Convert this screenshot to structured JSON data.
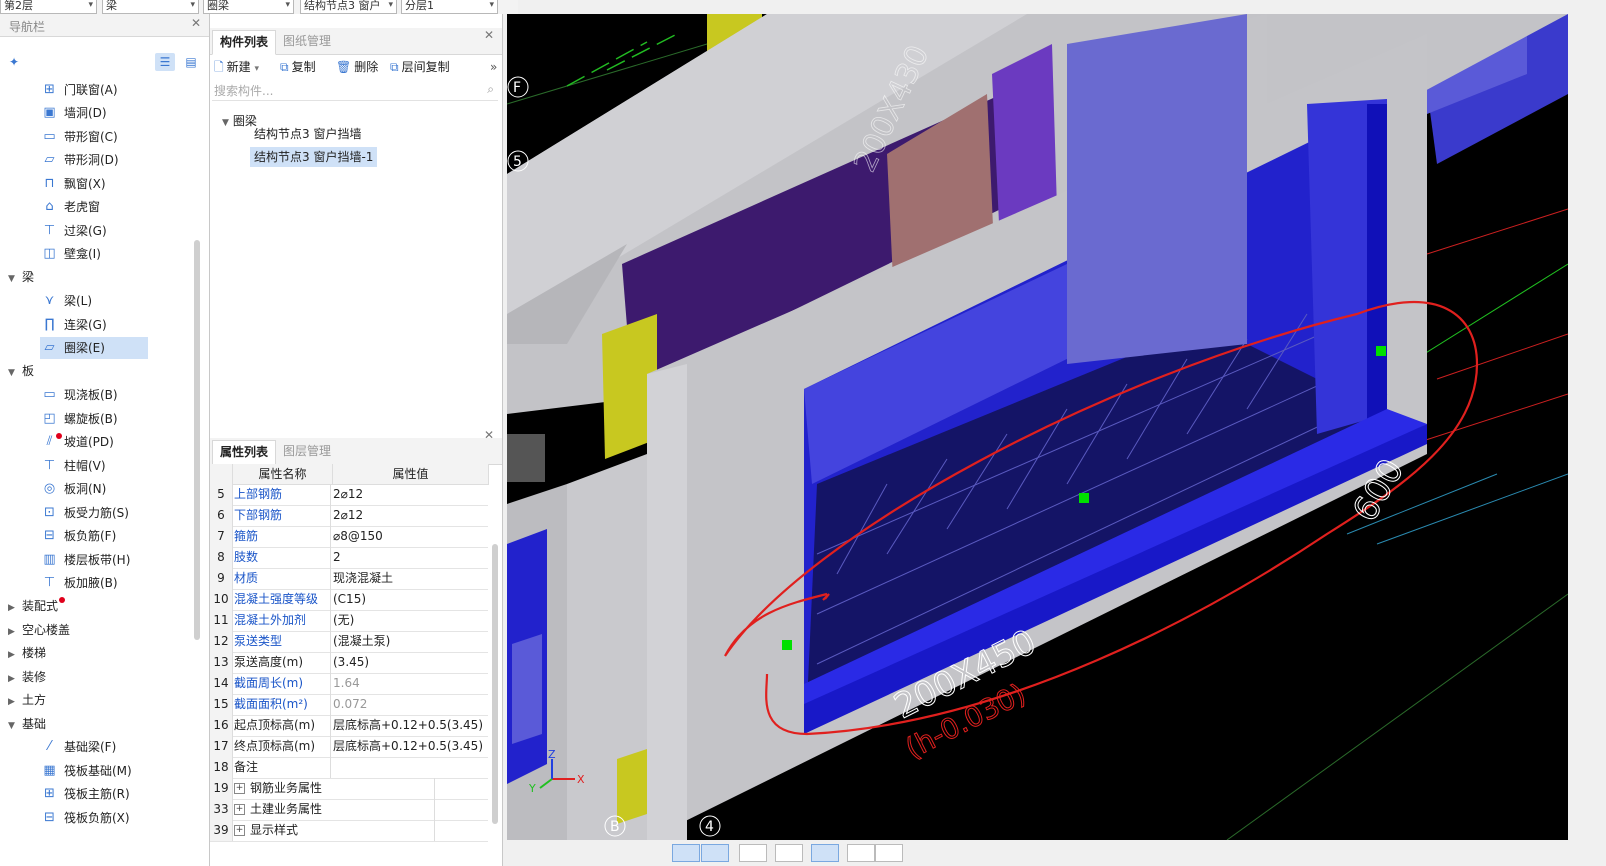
{
  "top_selectors": [
    "第2层",
    "梁",
    "圈梁",
    "结构节点3 窗户",
    "分层1"
  ],
  "nav": {
    "title": "导航栏",
    "items_opening": [
      {
        "label": "门联窗(A)",
        "icon": "door-window-icon"
      },
      {
        "label": "墙洞(D)",
        "icon": "wall-hole-icon"
      },
      {
        "label": "带形窗(C)",
        "icon": "strip-window-icon"
      },
      {
        "label": "带形洞(D)",
        "icon": "strip-hole-icon"
      },
      {
        "label": "飘窗(X)",
        "icon": "bay-window-icon"
      },
      {
        "label": "老虎窗",
        "icon": "dormer-icon"
      },
      {
        "label": "过梁(G)",
        "icon": "lintel-icon"
      },
      {
        "label": "壁龛(I)",
        "icon": "niche-icon"
      }
    ],
    "group_beam": "梁",
    "items_beam": [
      {
        "label": "梁(L)",
        "icon": "beam-icon"
      },
      {
        "label": "连梁(G)",
        "icon": "coupling-beam-icon"
      },
      {
        "label": "圈梁(E)",
        "icon": "ring-beam-icon"
      }
    ],
    "group_slab": "板",
    "items_slab": [
      {
        "label": "现浇板(B)",
        "icon": "cast-slab-icon"
      },
      {
        "label": "螺旋板(B)",
        "icon": "spiral-slab-icon"
      },
      {
        "label": "坡道(PD)",
        "icon": "ramp-icon"
      },
      {
        "label": "柱帽(V)",
        "icon": "column-cap-icon"
      },
      {
        "label": "板洞(N)",
        "icon": "slab-hole-icon"
      },
      {
        "label": "板受力筋(S)",
        "icon": "slab-rebar-icon"
      },
      {
        "label": "板负筋(F)",
        "icon": "slab-neg-rebar-icon"
      },
      {
        "label": "楼层板带(H)",
        "icon": "slab-strip-icon"
      },
      {
        "label": "板加腋(B)",
        "icon": "slab-haunch-icon"
      }
    ],
    "collapsed_groups": [
      "装配式",
      "空心楼盖",
      "楼梯",
      "装修",
      "土方"
    ],
    "group_foundation": "基础",
    "items_foundation": [
      {
        "label": "基础梁(F)",
        "icon": "foundation-beam-icon"
      },
      {
        "label": "筏板基础(M)",
        "icon": "raft-foundation-icon"
      },
      {
        "label": "筏板主筋(R)",
        "icon": "raft-main-rebar-icon"
      },
      {
        "label": "筏板负筋(X)",
        "icon": "raft-neg-rebar-icon"
      }
    ]
  },
  "component": {
    "tabs": [
      "构件列表",
      "图纸管理"
    ],
    "toolbar": {
      "new": "新建",
      "copy": "复制",
      "delete": "删除",
      "floor_copy": "层间复制"
    },
    "search_placeholder": "搜索构件...",
    "tree_root": "圈梁",
    "tree_items": [
      "结构节点3 窗户挡墙",
      "结构节点3 窗户挡墙-1"
    ]
  },
  "properties": {
    "tabs": [
      "属性列表",
      "图层管理"
    ],
    "headers": [
      "属性名称",
      "属性值"
    ],
    "rows": [
      {
        "no": "5",
        "name": "上部钢筋",
        "value": "2⌀12",
        "blue": true
      },
      {
        "no": "6",
        "name": "下部钢筋",
        "value": "2⌀12",
        "blue": true
      },
      {
        "no": "7",
        "name": "箍筋",
        "value": "⌀8@150",
        "blue": true
      },
      {
        "no": "8",
        "name": "肢数",
        "value": "2",
        "blue": true
      },
      {
        "no": "9",
        "name": "材质",
        "value": "现浇混凝土",
        "blue": true
      },
      {
        "no": "10",
        "name": "混凝土强度等级",
        "value": "(C15)",
        "blue": true
      },
      {
        "no": "11",
        "name": "混凝土外加剂",
        "value": "(无)",
        "blue": true
      },
      {
        "no": "12",
        "name": "泵送类型",
        "value": "(混凝土泵)",
        "blue": true
      },
      {
        "no": "13",
        "name": "泵送高度(m)",
        "value": "(3.45)",
        "blue": false
      },
      {
        "no": "14",
        "name": "截面周长(m)",
        "value": "1.64",
        "blue": true,
        "gray": true
      },
      {
        "no": "15",
        "name": "截面面积(m²)",
        "value": "0.072",
        "blue": true,
        "gray": true
      },
      {
        "no": "16",
        "name": "起点顶标高(m)",
        "value": "层底标高+0.12+0.5(3.45)",
        "blue": false
      },
      {
        "no": "17",
        "name": "终点顶标高(m)",
        "value": "层底标高+0.12+0.5(3.45)",
        "blue": false
      },
      {
        "no": "18",
        "name": "备注",
        "value": "",
        "blue": false
      },
      {
        "no": "19",
        "name": "钢筋业务属性",
        "value": "",
        "blue": false,
        "expand": true
      },
      {
        "no": "33",
        "name": "土建业务属性",
        "value": "",
        "blue": false,
        "expand": true
      },
      {
        "no": "39",
        "name": "显示样式",
        "value": "",
        "blue": false,
        "expand": true
      }
    ]
  },
  "viewport": {
    "labels": {
      "F": "F",
      "n5": "5",
      "B": "B",
      "n4": "4",
      "dim_beam": "200X450",
      "dim_600": "600",
      "dim_430": "200X430",
      "elev": "(h-0.030)"
    },
    "axis": {
      "x": "X",
      "y": "Y",
      "z": "Z"
    },
    "colors": {
      "wall": "#c8c8cc",
      "beam_blue": "#2222cc",
      "purple": "#3d1a6e",
      "yellow": "#c8c820",
      "annotation_red": "#e0201e",
      "grip_green": "#00e000"
    }
  }
}
